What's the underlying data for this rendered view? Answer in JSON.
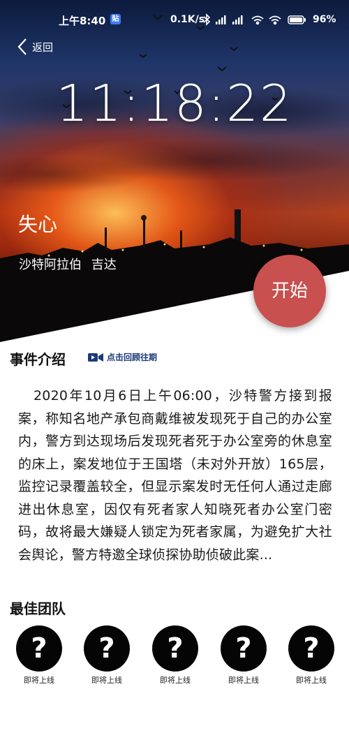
{
  "status_bar": {
    "time": "上午8:40",
    "badge": "贴",
    "net_speed": "0.1K/s",
    "battery": "96",
    "battery_suffix": "%",
    "icons": [
      "bluetooth-icon",
      "signal-hd-icon",
      "signal-hd-icon",
      "wifi-icon",
      "wifi-icon",
      "battery-icon"
    ]
  },
  "header": {
    "back_label": "返回"
  },
  "hero": {
    "timer": "11:18:22",
    "case_title": "失心",
    "location": "沙特阿拉伯 吉达",
    "start_label": "开始"
  },
  "intro": {
    "title": "事件介绍",
    "review_link": "点击回顾往期",
    "text": "2020年10月6日上午06:00，沙特警方接到报案，称知名地产承包商戴维被发现死于自己的办公室内，警方到达现场后发现死者死于办公室旁的休息室的床上，案发地位于王国塔（未对外开放）165层，监控记录覆盖较全，但显示案发时无任何人通过走廊进出休息室，因仅有死者家人知晓死者办公室门密码，故将最大嫌疑人锁定为死者家属，为避免扩大社会舆论，警方特邀全球侦探协助侦破此案..."
  },
  "team": {
    "title": "最佳团队",
    "members": [
      {
        "avatar": "?",
        "label": "即将上线"
      },
      {
        "avatar": "?",
        "label": "即将上线"
      },
      {
        "avatar": "?",
        "label": "即将上线"
      },
      {
        "avatar": "?",
        "label": "即将上线"
      },
      {
        "avatar": "?",
        "label": "即将上线"
      }
    ]
  }
}
